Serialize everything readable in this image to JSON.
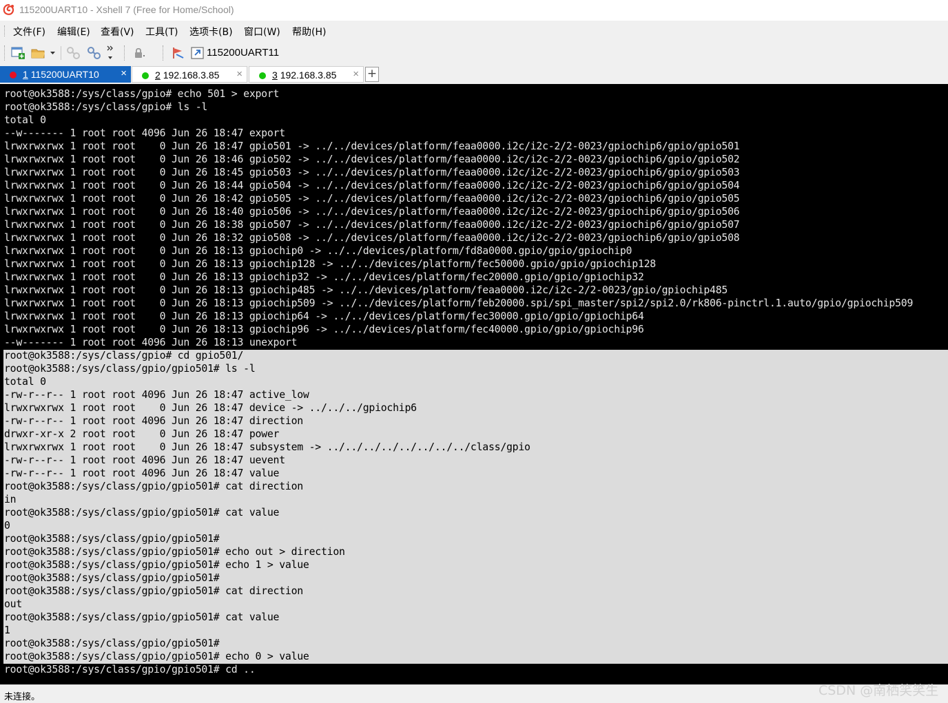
{
  "window": {
    "title": "115200UART10 - Xshell 7 (Free for Home/School)",
    "app_icon": "xshell-logo"
  },
  "menu": [
    {
      "label": "文件(F)"
    },
    {
      "label": "编辑(E)"
    },
    {
      "label": "查看(V)"
    },
    {
      "label": "工具(T)"
    },
    {
      "label": "选项卡(B)"
    },
    {
      "label": "窗口(W)"
    },
    {
      "label": "帮助(H)"
    }
  ],
  "toolbar": {
    "buttons": [
      {
        "icon": "new-session-icon"
      },
      {
        "icon": "open-folder-icon"
      },
      {
        "icon": "connect-icon"
      },
      {
        "icon": "disconnect-icon"
      },
      {
        "icon": "lock-icon"
      },
      {
        "icon": "bookmark-flag-icon"
      },
      {
        "icon": "link-shortcut-icon"
      }
    ],
    "link_label": "115200UART11"
  },
  "tabs": [
    {
      "num": "1",
      "label": "115200UART10",
      "status": "disconnected",
      "status_color": "#e81123",
      "active": true
    },
    {
      "num": "2",
      "label": "192.168.3.85",
      "status": "connected",
      "status_color": "#16c60c",
      "active": false
    },
    {
      "num": "3",
      "label": "192.168.3.85",
      "status": "connected",
      "status_color": "#16c60c",
      "active": false
    }
  ],
  "terminal": {
    "background": "#000000",
    "foreground": "#e6e6e6",
    "selection_background": "#dcdcdc",
    "lines": [
      "root@ok3588:/sys/class/gpio# echo 501 > export",
      "root@ok3588:/sys/class/gpio# ls -l",
      "total 0",
      "--w------- 1 root root 4096 Jun 26 18:47 export",
      "lrwxrwxrwx 1 root root    0 Jun 26 18:47 gpio501 -> ../../devices/platform/feaa0000.i2c/i2c-2/2-0023/gpiochip6/gpio/gpio501",
      "lrwxrwxrwx 1 root root    0 Jun 26 18:46 gpio502 -> ../../devices/platform/feaa0000.i2c/i2c-2/2-0023/gpiochip6/gpio/gpio502",
      "lrwxrwxrwx 1 root root    0 Jun 26 18:45 gpio503 -> ../../devices/platform/feaa0000.i2c/i2c-2/2-0023/gpiochip6/gpio/gpio503",
      "lrwxrwxrwx 1 root root    0 Jun 26 18:44 gpio504 -> ../../devices/platform/feaa0000.i2c/i2c-2/2-0023/gpiochip6/gpio/gpio504",
      "lrwxrwxrwx 1 root root    0 Jun 26 18:42 gpio505 -> ../../devices/platform/feaa0000.i2c/i2c-2/2-0023/gpiochip6/gpio/gpio505",
      "lrwxrwxrwx 1 root root    0 Jun 26 18:40 gpio506 -> ../../devices/platform/feaa0000.i2c/i2c-2/2-0023/gpiochip6/gpio/gpio506",
      "lrwxrwxrwx 1 root root    0 Jun 26 18:38 gpio507 -> ../../devices/platform/feaa0000.i2c/i2c-2/2-0023/gpiochip6/gpio/gpio507",
      "lrwxrwxrwx 1 root root    0 Jun 26 18:32 gpio508 -> ../../devices/platform/feaa0000.i2c/i2c-2/2-0023/gpiochip6/gpio/gpio508",
      "lrwxrwxrwx 1 root root    0 Jun 26 18:13 gpiochip0 -> ../../devices/platform/fd8a0000.gpio/gpio/gpiochip0",
      "lrwxrwxrwx 1 root root    0 Jun 26 18:13 gpiochip128 -> ../../devices/platform/fec50000.gpio/gpio/gpiochip128",
      "lrwxrwxrwx 1 root root    0 Jun 26 18:13 gpiochip32 -> ../../devices/platform/fec20000.gpio/gpio/gpiochip32",
      "lrwxrwxrwx 1 root root    0 Jun 26 18:13 gpiochip485 -> ../../devices/platform/feaa0000.i2c/i2c-2/2-0023/gpio/gpiochip485",
      "lrwxrwxrwx 1 root root    0 Jun 26 18:13 gpiochip509 -> ../../devices/platform/feb20000.spi/spi_master/spi2/spi2.0/rk806-pinctrl.1.auto/gpio/gpiochip509",
      "lrwxrwxrwx 1 root root    0 Jun 26 18:13 gpiochip64 -> ../../devices/platform/fec30000.gpio/gpio/gpiochip64",
      "lrwxrwxrwx 1 root root    0 Jun 26 18:13 gpiochip96 -> ../../devices/platform/fec40000.gpio/gpio/gpiochip96",
      "--w------- 1 root root 4096 Jun 26 18:13 unexport",
      "root@ok3588:/sys/class/gpio# cd gpio501/",
      "root@ok3588:/sys/class/gpio/gpio501# ls -l",
      "total 0",
      "-rw-r--r-- 1 root root 4096 Jun 26 18:47 active_low",
      "lrwxrwxrwx 1 root root    0 Jun 26 18:47 device -> ../../../gpiochip6",
      "-rw-r--r-- 1 root root 4096 Jun 26 18:47 direction",
      "drwxr-xr-x 2 root root    0 Jun 26 18:47 power",
      "lrwxrwxrwx 1 root root    0 Jun 26 18:47 subsystem -> ../../../../../../../../class/gpio",
      "-rw-r--r-- 1 root root 4096 Jun 26 18:47 uevent",
      "-rw-r--r-- 1 root root 4096 Jun 26 18:47 value",
      "root@ok3588:/sys/class/gpio/gpio501# cat direction",
      "in",
      "root@ok3588:/sys/class/gpio/gpio501# cat value",
      "0",
      "root@ok3588:/sys/class/gpio/gpio501#",
      "root@ok3588:/sys/class/gpio/gpio501# echo out > direction",
      "root@ok3588:/sys/class/gpio/gpio501# echo 1 > value",
      "root@ok3588:/sys/class/gpio/gpio501#",
      "root@ok3588:/sys/class/gpio/gpio501# cat direction",
      "out",
      "root@ok3588:/sys/class/gpio/gpio501# cat value",
      "1",
      "root@ok3588:/sys/class/gpio/gpio501#",
      "root@ok3588:/sys/class/gpio/gpio501# echo 0 > value",
      "root@ok3588:/sys/class/gpio/gpio501# cd .."
    ]
  },
  "status": {
    "text": "未连接。"
  },
  "watermark": "CSDN @南栖笑笑生"
}
